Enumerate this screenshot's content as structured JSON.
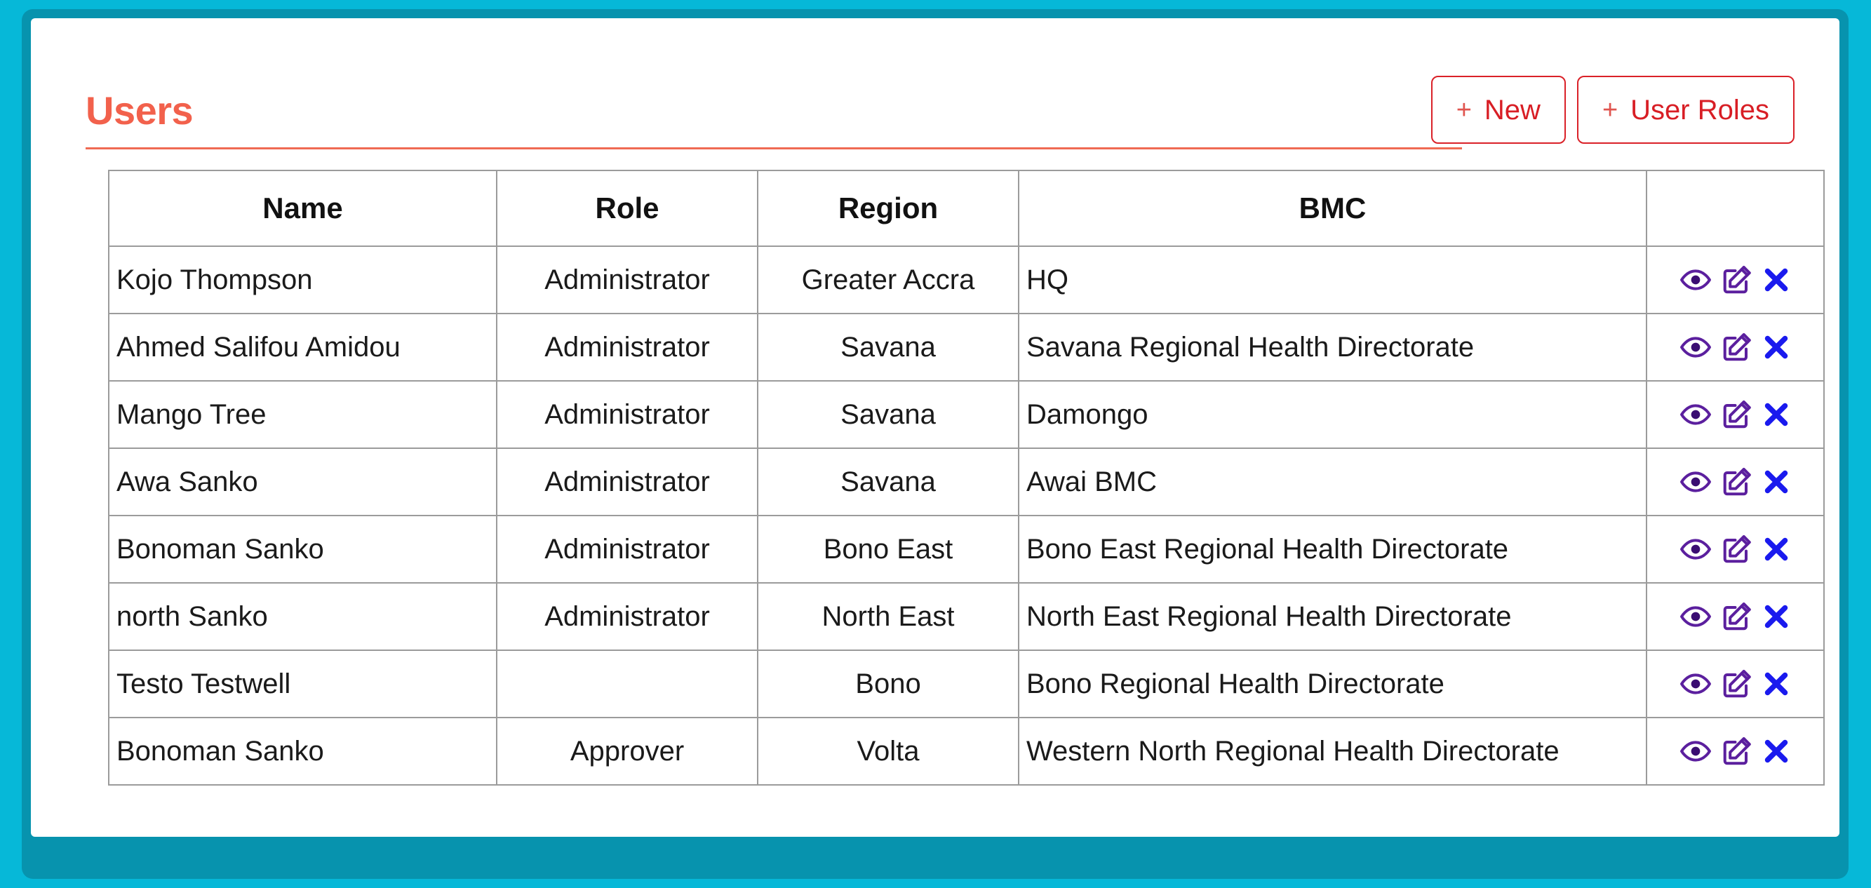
{
  "theme": {
    "page_background": "#06b8d8",
    "frame_border": "#0793ae",
    "card_background": "#ffffff",
    "title_color": "#f2614c",
    "title_rule_color": "#ef6a53",
    "button_border_color": "#da2128",
    "button_text_color": "#d81e25",
    "button_plus_color": "#e0554f",
    "table_border_color": "#9b9b9b",
    "view_icon_color": "#5b1f9e",
    "edit_icon_color": "#5b1f9e",
    "delete_icon_color": "#1a1aee"
  },
  "header": {
    "title": "Users",
    "buttons": [
      {
        "plus": "+",
        "label": "New",
        "name": "new-button"
      },
      {
        "plus": "+",
        "label": "User Roles",
        "name": "user-roles-button"
      }
    ]
  },
  "table": {
    "columns": [
      {
        "key": "name",
        "label": "Name"
      },
      {
        "key": "role",
        "label": "Role"
      },
      {
        "key": "region",
        "label": "Region"
      },
      {
        "key": "bmc",
        "label": "BMC"
      },
      {
        "key": "actions",
        "label": ""
      }
    ],
    "row_actions": [
      {
        "name": "view-icon",
        "title": "View"
      },
      {
        "name": "edit-icon",
        "title": "Edit"
      },
      {
        "name": "delete-icon",
        "title": "Delete"
      }
    ],
    "rows": [
      {
        "name": "Kojo Thompson",
        "role": "Administrator",
        "region": "Greater Accra",
        "bmc": "HQ"
      },
      {
        "name": "Ahmed Salifou Amidou",
        "role": "Administrator",
        "region": "Savana",
        "bmc": "Savana Regional Health Directorate"
      },
      {
        "name": "Mango Tree",
        "role": "Administrator",
        "region": "Savana",
        "bmc": "Damongo"
      },
      {
        "name": "Awa Sanko",
        "role": "Administrator",
        "region": "Savana",
        "bmc": "Awai BMC"
      },
      {
        "name": "Bonoman Sanko",
        "role": "Administrator",
        "region": "Bono East",
        "bmc": "Bono East Regional Health Directorate"
      },
      {
        "name": "north Sanko",
        "role": "Administrator",
        "region": "North East",
        "bmc": "North East Regional Health Directorate"
      },
      {
        "name": "Testo Testwell",
        "role": "",
        "region": "Bono",
        "bmc": "Bono Regional Health Directorate"
      },
      {
        "name": "Bonoman Sanko",
        "role": "Approver",
        "region": "Volta",
        "bmc": "Western North Regional Health Directorate"
      }
    ]
  }
}
